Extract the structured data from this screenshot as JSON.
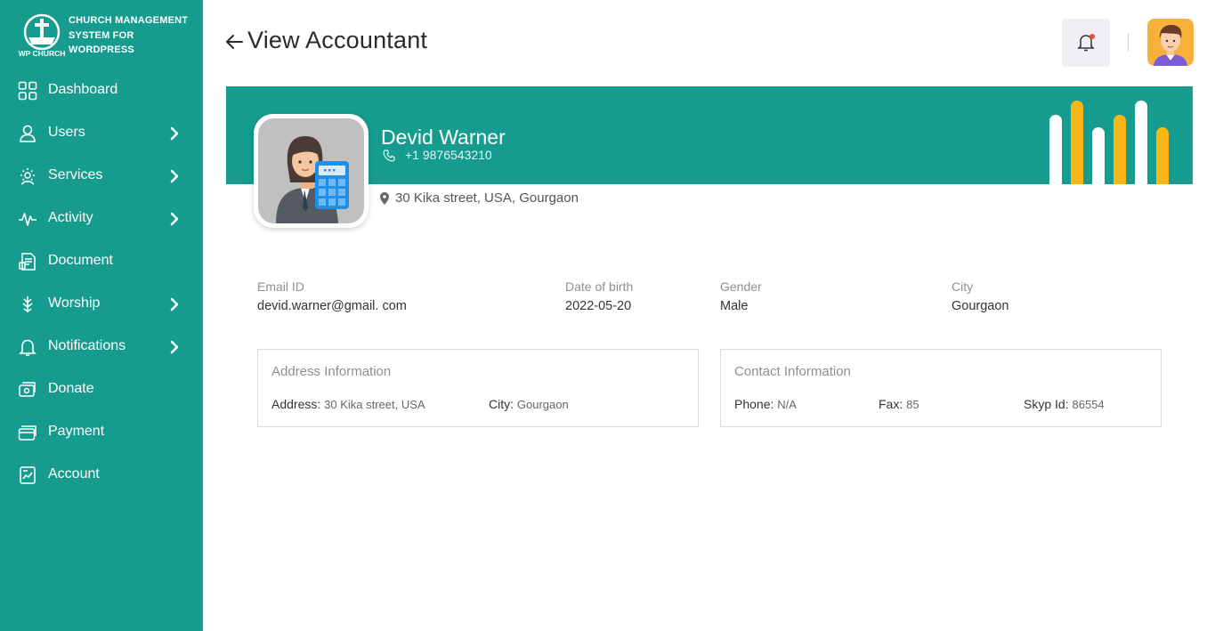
{
  "brand": {
    "logo_text": "WP CHURCH",
    "title": "CHURCH MANAGEMENT SYSTEM FOR WORDPRESS"
  },
  "sidebar": {
    "items": [
      {
        "label": "Dashboard",
        "icon": "dashboard-icon",
        "has_submenu": false
      },
      {
        "label": "Users",
        "icon": "user-icon",
        "has_submenu": true
      },
      {
        "label": "Services",
        "icon": "services-icon",
        "has_submenu": true
      },
      {
        "label": "Activity",
        "icon": "activity-icon",
        "has_submenu": true
      },
      {
        "label": "Document",
        "icon": "document-icon",
        "has_submenu": false
      },
      {
        "label": "Worship",
        "icon": "worship-icon",
        "has_submenu": true
      },
      {
        "label": "Notifications",
        "icon": "bell-icon",
        "has_submenu": true
      },
      {
        "label": "Donate",
        "icon": "donate-icon",
        "has_submenu": false
      },
      {
        "label": "Payment",
        "icon": "payment-icon",
        "has_submenu": false
      },
      {
        "label": "Account",
        "icon": "account-icon",
        "has_submenu": false
      }
    ]
  },
  "header": {
    "title": "View Accountant"
  },
  "profile": {
    "name": "Devid Warner",
    "phone": "+1 9876543210",
    "address": "30 Kika street, USA, Gourgaon"
  },
  "details": {
    "email_label": "Email ID",
    "email": "devid.warner@gmail. com",
    "dob_label": "Date of birth",
    "dob": "2022-05-20",
    "gender_label": "Gender",
    "gender": "Male",
    "city_label": "City",
    "city": "Gourgaon"
  },
  "address_info": {
    "title": "Address Information",
    "address_label": "Address:",
    "address": "30 Kika street, USA",
    "city_label": "City:",
    "city": "Gourgaon"
  },
  "contact_info": {
    "title": "Contact Information",
    "phone_label": "Phone:",
    "phone": "N/A",
    "fax_label": "Fax:",
    "fax": "85",
    "skype_label": "Skyp Id:",
    "skype": "86554"
  },
  "colors": {
    "primary": "#169b8f",
    "accent": "#fbb614",
    "bell_bg": "#eef0f4"
  }
}
